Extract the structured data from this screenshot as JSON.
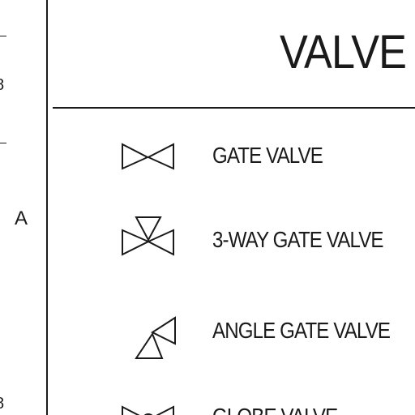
{
  "sheet": {
    "zone_letter": "A",
    "title": "VALVE"
  },
  "legend": [
    {
      "label": "GATE VALVE",
      "symbol": "gate-valve"
    },
    {
      "label": "3-WAY GATE VALVE",
      "symbol": "3-way-gate-valve"
    },
    {
      "label": "ANGLE GATE VALVE",
      "symbol": "angle-gate-valve"
    },
    {
      "label": "GLOBE VALVE",
      "symbol": "globe-valve"
    }
  ]
}
